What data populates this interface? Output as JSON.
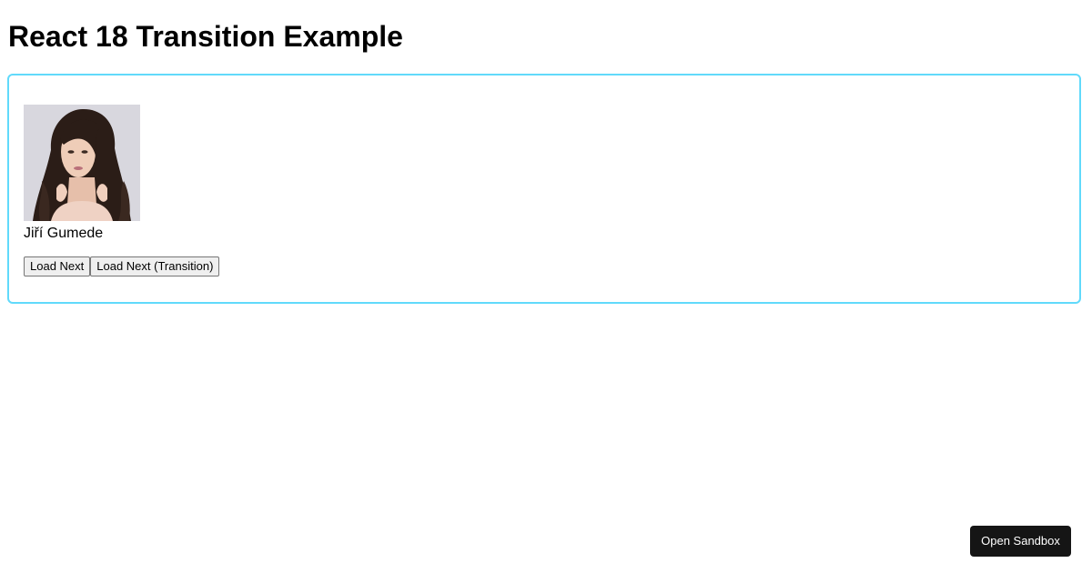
{
  "page": {
    "title": "React 18 Transition Example"
  },
  "card": {
    "border_color": "#61dafb",
    "person": {
      "name": "Jiří Gumede",
      "avatar_icon": "portrait-photo"
    },
    "buttons": {
      "load_next": "Load Next",
      "load_next_transition": "Load Next (Transition)"
    }
  },
  "footer": {
    "open_sandbox": "Open Sandbox"
  }
}
